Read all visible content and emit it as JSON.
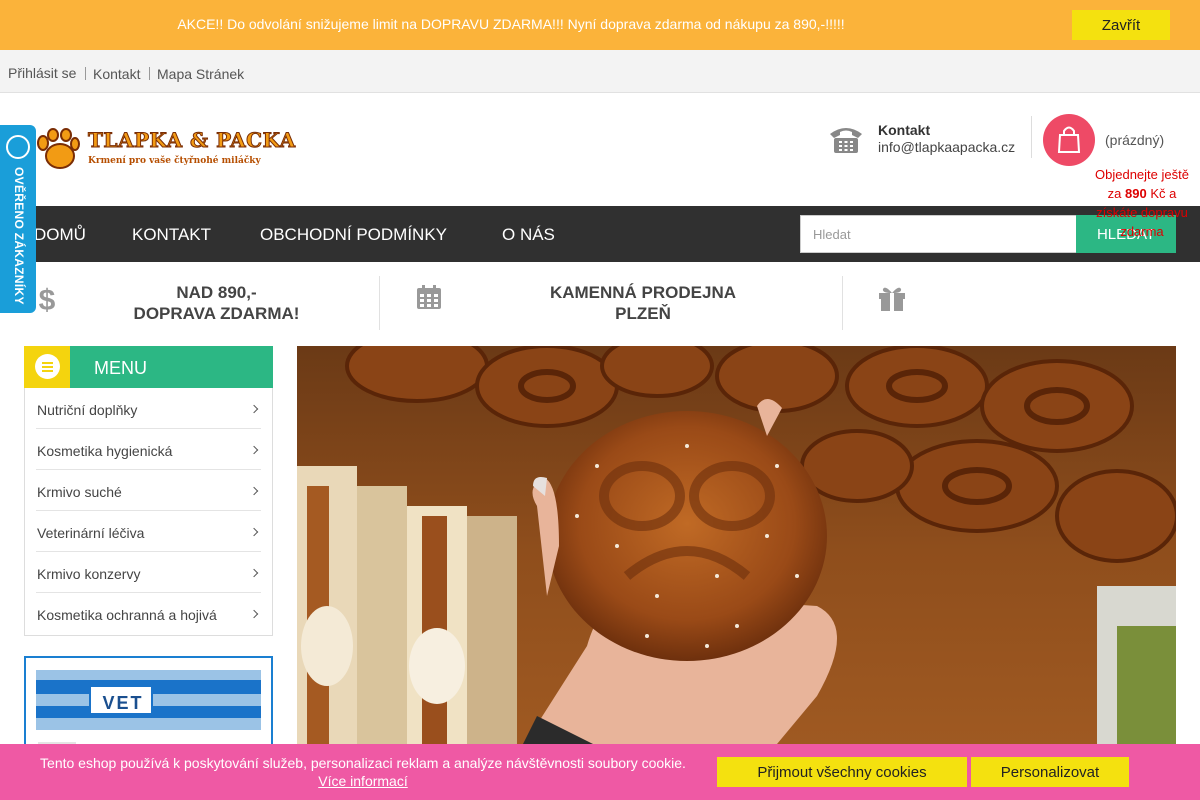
{
  "promo": {
    "text": "AKCE!! Do odvolání snižujeme limit na DOPRAVU ZDARMA!!! Nyní doprava zdarma od nákupu za 890,-!!!!!",
    "close_label": "Zavřít"
  },
  "top_links": [
    "Přihlásit se",
    "Kontakt",
    "Mapa Stránek"
  ],
  "logo": {
    "title": "TLAPKA & PACKA",
    "subtitle": "Krmení pro vaše čtyřnohé miláčky"
  },
  "verified_badge": "OVĚŘENO ZÁKAZNÍKY",
  "contact": {
    "label": "Kontakt",
    "email": "info@tlapkaapacka.cz"
  },
  "cart": {
    "status": "(prázdný)",
    "note_prefix": "Objednejte ještě za",
    "note_amount": "890",
    "note_suffix": "Kč a získáte dopravu zdarma"
  },
  "nav": {
    "items": [
      "DOMŮ",
      "KONTAKT",
      "OBCHODNÍ PODMÍNKY",
      "O NÁS"
    ],
    "search_placeholder": "Hledat",
    "search_button": "HLEDAT"
  },
  "benefits": [
    {
      "icon": "dollar-icon",
      "line1": "NAD 890,-",
      "line2": "DOPRAVA ZDARMA!"
    },
    {
      "icon": "calendar-icon",
      "line1": "KAMENNÁ PRODEJNA",
      "line2": "PLZEŇ"
    },
    {
      "icon": "gift-icon",
      "line1": "",
      "line2": ""
    }
  ],
  "sidebar": {
    "menu_title": "MENU",
    "items": [
      "Nutriční doplňky",
      "Kosmetika hygienická",
      "Krmivo suché",
      "Veterinární léčiva",
      "Krmivo konzervy",
      "Kosmetika ochranná a hojivá"
    ],
    "vet_banner_text": "VET"
  },
  "cookie": {
    "text": "Tento eshop používá k poskytování služeb, personalizaci reklam a analýze návštěvnosti soubory cookie.",
    "more_link": "Více informací",
    "accept_all": "Přijmout všechny cookies",
    "personalize": "Personalizovat"
  },
  "colors": {
    "promo_bg": "#fbb33a",
    "accent_yellow": "#f4e10f",
    "accent_green": "#2cb784",
    "nav_bg": "#303030",
    "cart_pink": "#ee4a66",
    "cookie_bg": "#ef59a4",
    "badge_blue": "#1a9ed9"
  }
}
